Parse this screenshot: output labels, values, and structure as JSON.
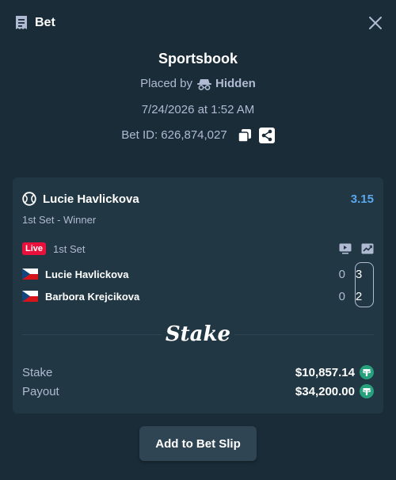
{
  "header": {
    "title": "Bet",
    "receipt_icon": "receipt-icon",
    "close_icon": "close-icon"
  },
  "meta": {
    "title": "Sportsbook",
    "placed_by_label": "Placed by",
    "placed_by_user": "Hidden",
    "date": "7/24/2026 at 1:52 AM",
    "bet_id": "Bet ID: 626,874,027"
  },
  "bet": {
    "outcome": "Lucie Havlickova",
    "odds": "3.15",
    "market": "1st Set - Winner",
    "live_label": "Live",
    "live_period": "1st Set",
    "players": [
      {
        "name": "Lucie Havlickova",
        "sets": "0",
        "games": "3",
        "flag": "czech-flag"
      },
      {
        "name": "Barbora Krejcikova",
        "sets": "0",
        "games": "2",
        "flag": "czech-flag"
      }
    ],
    "brand": "Stake",
    "stake_label": "Stake",
    "stake_value": "$10,857.14",
    "payout_label": "Payout",
    "payout_value": "$34,200.00"
  },
  "actions": {
    "add_to_slip": "Add to Bet Slip"
  },
  "colors": {
    "background": "#1a2c38",
    "card": "#213743",
    "odds": "#5ba8f1",
    "live": "#e9113c",
    "tether": "#26a17b",
    "muted": "#b1bad3"
  }
}
